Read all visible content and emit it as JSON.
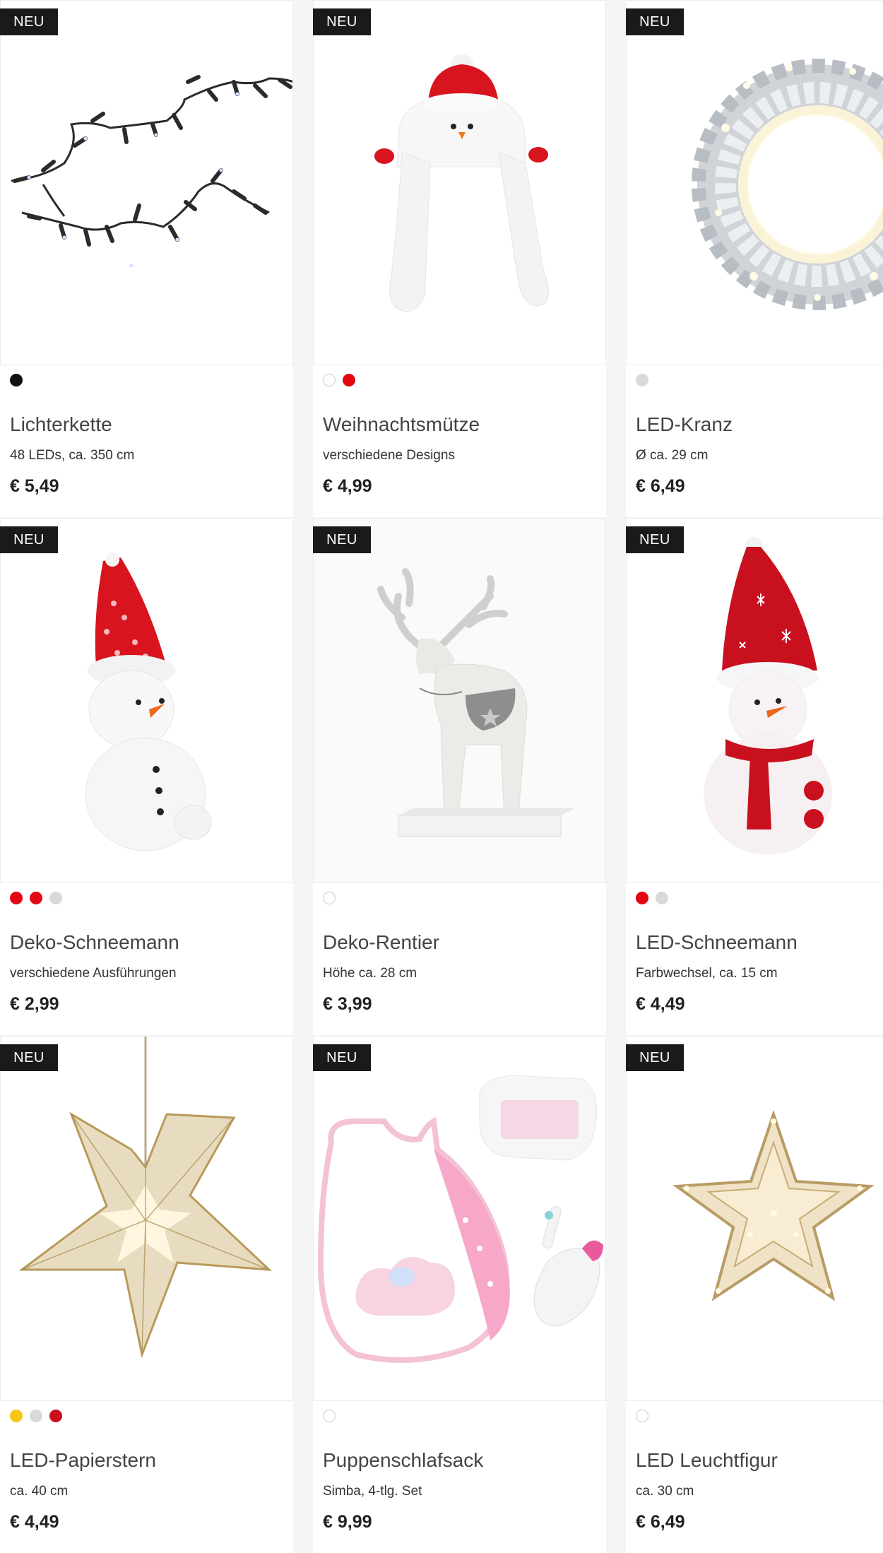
{
  "products": [
    {
      "badge": "NEU",
      "title": "Lichterkette",
      "subtitle": "48 LEDs, ca. 350 cm",
      "price": "€ 5,49",
      "image": "light-chain-image",
      "swatches": [
        "#111111"
      ]
    },
    {
      "badge": "NEU",
      "title": "Weihnachtsmütze",
      "subtitle": "verschiedene Designs",
      "price": "€ 4,99",
      "image": "snowman-hat-image",
      "swatches": [
        "#ffffff",
        "#e30613"
      ]
    },
    {
      "badge": "NEU",
      "title": "LED-Kranz",
      "subtitle": "Ø ca. 29 cm",
      "price": "€ 6,49",
      "image": "led-wreath-image",
      "swatches": [
        "#d9d9d9"
      ]
    },
    {
      "badge": "NEU",
      "title": "Deko-Schneemann",
      "subtitle": "verschiedene Ausführungen",
      "price": "€ 2,99",
      "image": "snowman-figure-image",
      "swatches": [
        "#e30613",
        "#e30613",
        "#d9d9d9"
      ]
    },
    {
      "badge": "NEU",
      "title": "Deko-Rentier",
      "subtitle": "Höhe ca. 28 cm",
      "price": "€ 3,99",
      "image": "reindeer-figure-image",
      "swatches": [
        "#ffffff"
      ]
    },
    {
      "badge": "NEU",
      "title": "LED-Schneemann",
      "subtitle": "Farbwechsel, ca. 15 cm",
      "price": "€ 4,49",
      "image": "led-snowman-image",
      "swatches": [
        "#e30613",
        "#d9d9d9"
      ]
    },
    {
      "badge": "NEU",
      "title": "LED-Papierstern",
      "subtitle": "ca. 40 cm",
      "price": "€ 4,49",
      "image": "paper-star-image",
      "swatches": [
        "#f5c518",
        "#d9d9d9",
        "#c8101e"
      ]
    },
    {
      "badge": "NEU",
      "title": "Puppenschlafsack",
      "subtitle": "Simba, 4-tlg. Set",
      "price": "€ 9,99",
      "image": "doll-sleeping-bag-image",
      "swatches": [
        "#ffffff"
      ]
    },
    {
      "badge": "NEU",
      "title": "LED Leuchtfigur",
      "subtitle": "ca. 30 cm",
      "price": "€ 6,49",
      "image": "led-star-figure-image",
      "swatches": [
        "#ffffff"
      ]
    }
  ]
}
